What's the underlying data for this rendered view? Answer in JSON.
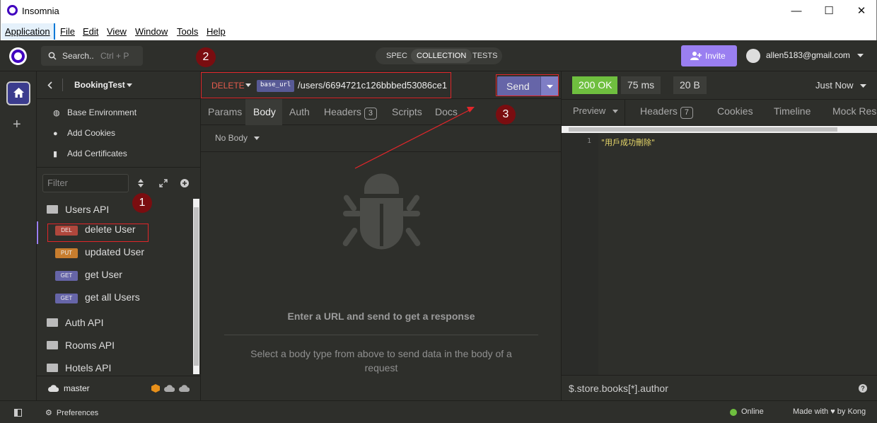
{
  "window": {
    "title": "Insomnia",
    "minimize": "—",
    "maximize": "☐",
    "close": "✕"
  },
  "menu": [
    "Application",
    "File",
    "Edit",
    "View",
    "Window",
    "Tools",
    "Help"
  ],
  "appbar": {
    "search_label": "Search..",
    "search_shortcut": "Ctrl + P",
    "modes": [
      "SPEC",
      "COLLECTION",
      "TESTS"
    ],
    "active_mode": "COLLECTION",
    "invite_label": "Invite",
    "user_email": "allen5183@gmail.com"
  },
  "sidebar": {
    "collection_name": "BookingTest",
    "links": [
      {
        "icon": "globe-icon",
        "label": "Base Environment"
      },
      {
        "icon": "cookie-icon",
        "label": "Add Cookies"
      },
      {
        "icon": "certificate-icon",
        "label": "Add Certificates"
      }
    ],
    "filter_placeholder": "Filter",
    "tree": {
      "open_folder": "Users API",
      "requests": [
        {
          "method": "DEL",
          "name": "delete User",
          "active": true
        },
        {
          "method": "PUT",
          "name": "updated User"
        },
        {
          "method": "GET",
          "name": "get User"
        },
        {
          "method": "GET",
          "name": "get all Users"
        }
      ],
      "folders": [
        "Auth API",
        "Rooms API",
        "Hotels API"
      ]
    },
    "branch": "master"
  },
  "request": {
    "method": "DELETE",
    "base_url_tag": "base_url",
    "url_path": "/users/6694721c126bbbed53086ce1",
    "send_label": "Send",
    "tabs": [
      {
        "label": "Params"
      },
      {
        "label": "Body",
        "active": true
      },
      {
        "label": "Auth"
      },
      {
        "label": "Headers",
        "count": "3"
      },
      {
        "label": "Scripts"
      },
      {
        "label": "Docs"
      }
    ],
    "body_type": "No Body",
    "empty_message": "Enter a URL and send to get a response",
    "empty_hint": "Select a body type from above to send data in the body of a request"
  },
  "response": {
    "status": "200 OK",
    "time": "75 ms",
    "size": "20 B",
    "when": "Just Now",
    "tabs": [
      {
        "label": "Preview"
      },
      {
        "label": "Headers",
        "count": "7"
      },
      {
        "label": "Cookies"
      },
      {
        "label": "Timeline"
      },
      {
        "label": "Mock Resp"
      }
    ],
    "line_number": "1",
    "body": "\"用戶成功刪除\"",
    "filter_query": "$.store.books[*].author",
    "help_icon": "?"
  },
  "statusbar": {
    "preferences": "Preferences",
    "online": "Online",
    "made_with_prefix": "Made with",
    "made_with_suffix": "by Kong"
  },
  "annotations": {
    "step1": "1",
    "step2": "2",
    "step3": "3",
    "color": "#e0262a"
  },
  "colors": {
    "accent": "#9a7ff1",
    "success": "#6fbf3f",
    "delete": "#e55b4d",
    "send": "#6665a8"
  }
}
